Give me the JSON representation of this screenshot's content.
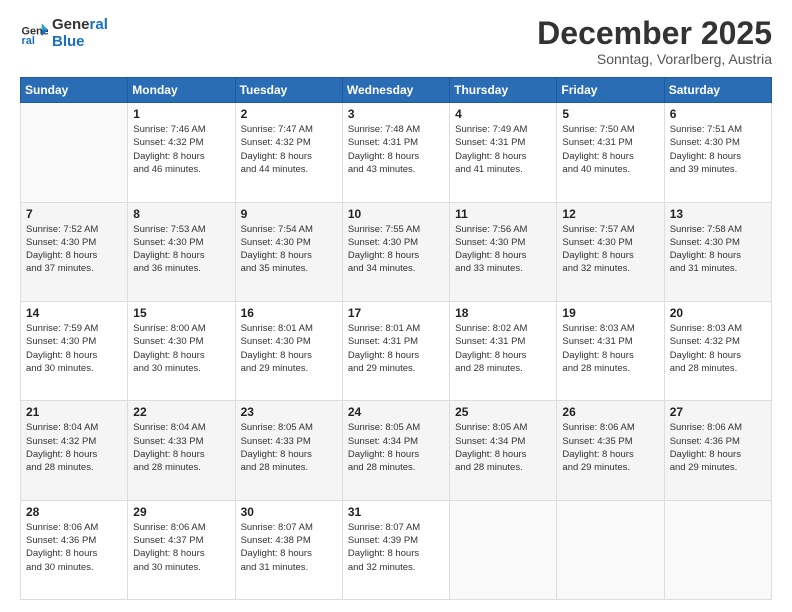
{
  "logo": {
    "line1": "General",
    "line2": "Blue"
  },
  "header": {
    "month": "December 2025",
    "location": "Sonntag, Vorarlberg, Austria"
  },
  "weekdays": [
    "Sunday",
    "Monday",
    "Tuesday",
    "Wednesday",
    "Thursday",
    "Friday",
    "Saturday"
  ],
  "weeks": [
    [
      {
        "day": "",
        "info": ""
      },
      {
        "day": "1",
        "info": "Sunrise: 7:46 AM\nSunset: 4:32 PM\nDaylight: 8 hours\nand 46 minutes."
      },
      {
        "day": "2",
        "info": "Sunrise: 7:47 AM\nSunset: 4:32 PM\nDaylight: 8 hours\nand 44 minutes."
      },
      {
        "day": "3",
        "info": "Sunrise: 7:48 AM\nSunset: 4:31 PM\nDaylight: 8 hours\nand 43 minutes."
      },
      {
        "day": "4",
        "info": "Sunrise: 7:49 AM\nSunset: 4:31 PM\nDaylight: 8 hours\nand 41 minutes."
      },
      {
        "day": "5",
        "info": "Sunrise: 7:50 AM\nSunset: 4:31 PM\nDaylight: 8 hours\nand 40 minutes."
      },
      {
        "day": "6",
        "info": "Sunrise: 7:51 AM\nSunset: 4:30 PM\nDaylight: 8 hours\nand 39 minutes."
      }
    ],
    [
      {
        "day": "7",
        "info": "Sunrise: 7:52 AM\nSunset: 4:30 PM\nDaylight: 8 hours\nand 37 minutes."
      },
      {
        "day": "8",
        "info": "Sunrise: 7:53 AM\nSunset: 4:30 PM\nDaylight: 8 hours\nand 36 minutes."
      },
      {
        "day": "9",
        "info": "Sunrise: 7:54 AM\nSunset: 4:30 PM\nDaylight: 8 hours\nand 35 minutes."
      },
      {
        "day": "10",
        "info": "Sunrise: 7:55 AM\nSunset: 4:30 PM\nDaylight: 8 hours\nand 34 minutes."
      },
      {
        "day": "11",
        "info": "Sunrise: 7:56 AM\nSunset: 4:30 PM\nDaylight: 8 hours\nand 33 minutes."
      },
      {
        "day": "12",
        "info": "Sunrise: 7:57 AM\nSunset: 4:30 PM\nDaylight: 8 hours\nand 32 minutes."
      },
      {
        "day": "13",
        "info": "Sunrise: 7:58 AM\nSunset: 4:30 PM\nDaylight: 8 hours\nand 31 minutes."
      }
    ],
    [
      {
        "day": "14",
        "info": "Sunrise: 7:59 AM\nSunset: 4:30 PM\nDaylight: 8 hours\nand 30 minutes."
      },
      {
        "day": "15",
        "info": "Sunrise: 8:00 AM\nSunset: 4:30 PM\nDaylight: 8 hours\nand 30 minutes."
      },
      {
        "day": "16",
        "info": "Sunrise: 8:01 AM\nSunset: 4:30 PM\nDaylight: 8 hours\nand 29 minutes."
      },
      {
        "day": "17",
        "info": "Sunrise: 8:01 AM\nSunset: 4:31 PM\nDaylight: 8 hours\nand 29 minutes."
      },
      {
        "day": "18",
        "info": "Sunrise: 8:02 AM\nSunset: 4:31 PM\nDaylight: 8 hours\nand 28 minutes."
      },
      {
        "day": "19",
        "info": "Sunrise: 8:03 AM\nSunset: 4:31 PM\nDaylight: 8 hours\nand 28 minutes."
      },
      {
        "day": "20",
        "info": "Sunrise: 8:03 AM\nSunset: 4:32 PM\nDaylight: 8 hours\nand 28 minutes."
      }
    ],
    [
      {
        "day": "21",
        "info": "Sunrise: 8:04 AM\nSunset: 4:32 PM\nDaylight: 8 hours\nand 28 minutes."
      },
      {
        "day": "22",
        "info": "Sunrise: 8:04 AM\nSunset: 4:33 PM\nDaylight: 8 hours\nand 28 minutes."
      },
      {
        "day": "23",
        "info": "Sunrise: 8:05 AM\nSunset: 4:33 PM\nDaylight: 8 hours\nand 28 minutes."
      },
      {
        "day": "24",
        "info": "Sunrise: 8:05 AM\nSunset: 4:34 PM\nDaylight: 8 hours\nand 28 minutes."
      },
      {
        "day": "25",
        "info": "Sunrise: 8:05 AM\nSunset: 4:34 PM\nDaylight: 8 hours\nand 28 minutes."
      },
      {
        "day": "26",
        "info": "Sunrise: 8:06 AM\nSunset: 4:35 PM\nDaylight: 8 hours\nand 29 minutes."
      },
      {
        "day": "27",
        "info": "Sunrise: 8:06 AM\nSunset: 4:36 PM\nDaylight: 8 hours\nand 29 minutes."
      }
    ],
    [
      {
        "day": "28",
        "info": "Sunrise: 8:06 AM\nSunset: 4:36 PM\nDaylight: 8 hours\nand 30 minutes."
      },
      {
        "day": "29",
        "info": "Sunrise: 8:06 AM\nSunset: 4:37 PM\nDaylight: 8 hours\nand 30 minutes."
      },
      {
        "day": "30",
        "info": "Sunrise: 8:07 AM\nSunset: 4:38 PM\nDaylight: 8 hours\nand 31 minutes."
      },
      {
        "day": "31",
        "info": "Sunrise: 8:07 AM\nSunset: 4:39 PM\nDaylight: 8 hours\nand 32 minutes."
      },
      {
        "day": "",
        "info": ""
      },
      {
        "day": "",
        "info": ""
      },
      {
        "day": "",
        "info": ""
      }
    ]
  ]
}
